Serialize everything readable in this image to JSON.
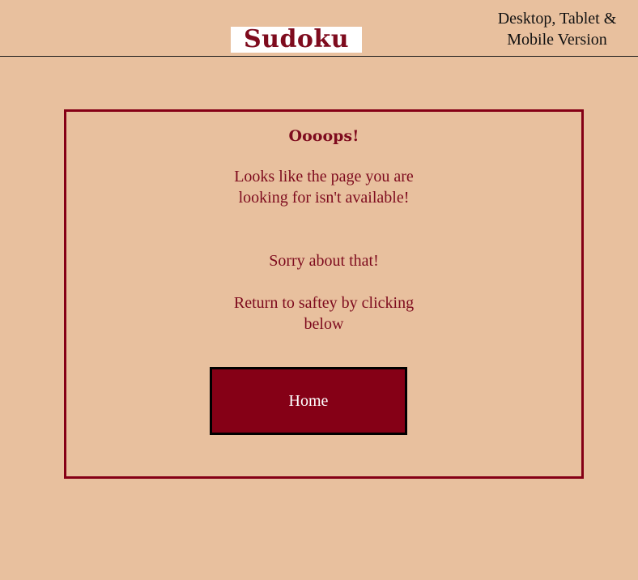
{
  "header": {
    "logo_text": "Sudoku",
    "version_line1": "Desktop, Tablet &",
    "version_line2": "Mobile Version"
  },
  "error_card": {
    "title": "Oooops!",
    "message_1": "Looks like the page you are looking for isn't available!",
    "message_2": "Sorry about that!",
    "message_3": "Return to saftey by clicking below",
    "home_button_label": "Home"
  },
  "colors": {
    "background": "#e8c09e",
    "accent": "#850016",
    "text_dark": "#111111",
    "logo_background": "#ffffff"
  }
}
